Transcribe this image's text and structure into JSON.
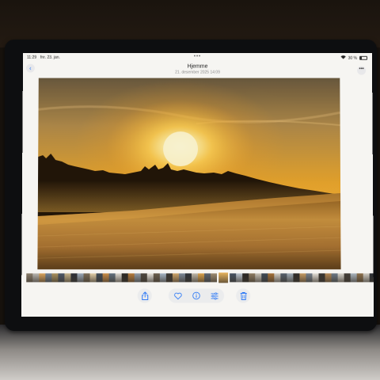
{
  "status_bar": {
    "time": "11:29",
    "date": "fre. 23. jan.",
    "wifi_icon": "wifi-icon",
    "battery_percent": "30 %",
    "battery_level": 0.3
  },
  "header": {
    "title": "Hjemme",
    "subtitle": "21. desember 2025 14:09",
    "back_icon": "chevron-left-icon",
    "more_icon": "ellipsis-icon"
  },
  "photo": {
    "subject": "sunset over frosty field with forest treeline"
  },
  "thumbnail_strip": {
    "colors": [
      "#8a7d6c",
      "#b9b6b0",
      "#d8a25a",
      "#6c7f93",
      "#a8905d",
      "#4a5667",
      "#c3b28a",
      "#2d3036",
      "#9aa7b6",
      "#7a6b55",
      "#e1cda6",
      "#3e4a57",
      "#c98c46",
      "#5f6e7c",
      "#dbd7cf",
      "#2b2824",
      "#b57a3a",
      "#8f9aa6",
      "#4c463e",
      "#e4e0d8",
      "#6a5d4c",
      "#a4b4c4",
      "#3a3732",
      "#cda46a",
      "#7b8796",
      "#2f3339",
      "#bfb7a8",
      "#d9a04a",
      "#5a6470",
      "#9c8a70",
      "#e6b25c",
      "#465160",
      "#b9c2cc",
      "#2a2622",
      "#8c7a60",
      "#c7c1b6",
      "#3d4854",
      "#a46f36",
      "#d2cec6",
      "#55606c",
      "#9da9b4",
      "#2e2b27",
      "#c49a62",
      "#737f8b",
      "#e2ded6",
      "#383530",
      "#b08552",
      "#6b7886",
      "#d6d2ca",
      "#423d36",
      "#a9b3bd",
      "#8b6e4a",
      "#cfcbc3",
      "#2c3035"
    ],
    "selected_index": 30
  },
  "toolbar": {
    "share_icon": "share-icon",
    "favorite_icon": "heart-icon",
    "info_icon": "info-icon",
    "adjust_icon": "adjust-sliders-icon",
    "delete_icon": "trash-icon"
  }
}
